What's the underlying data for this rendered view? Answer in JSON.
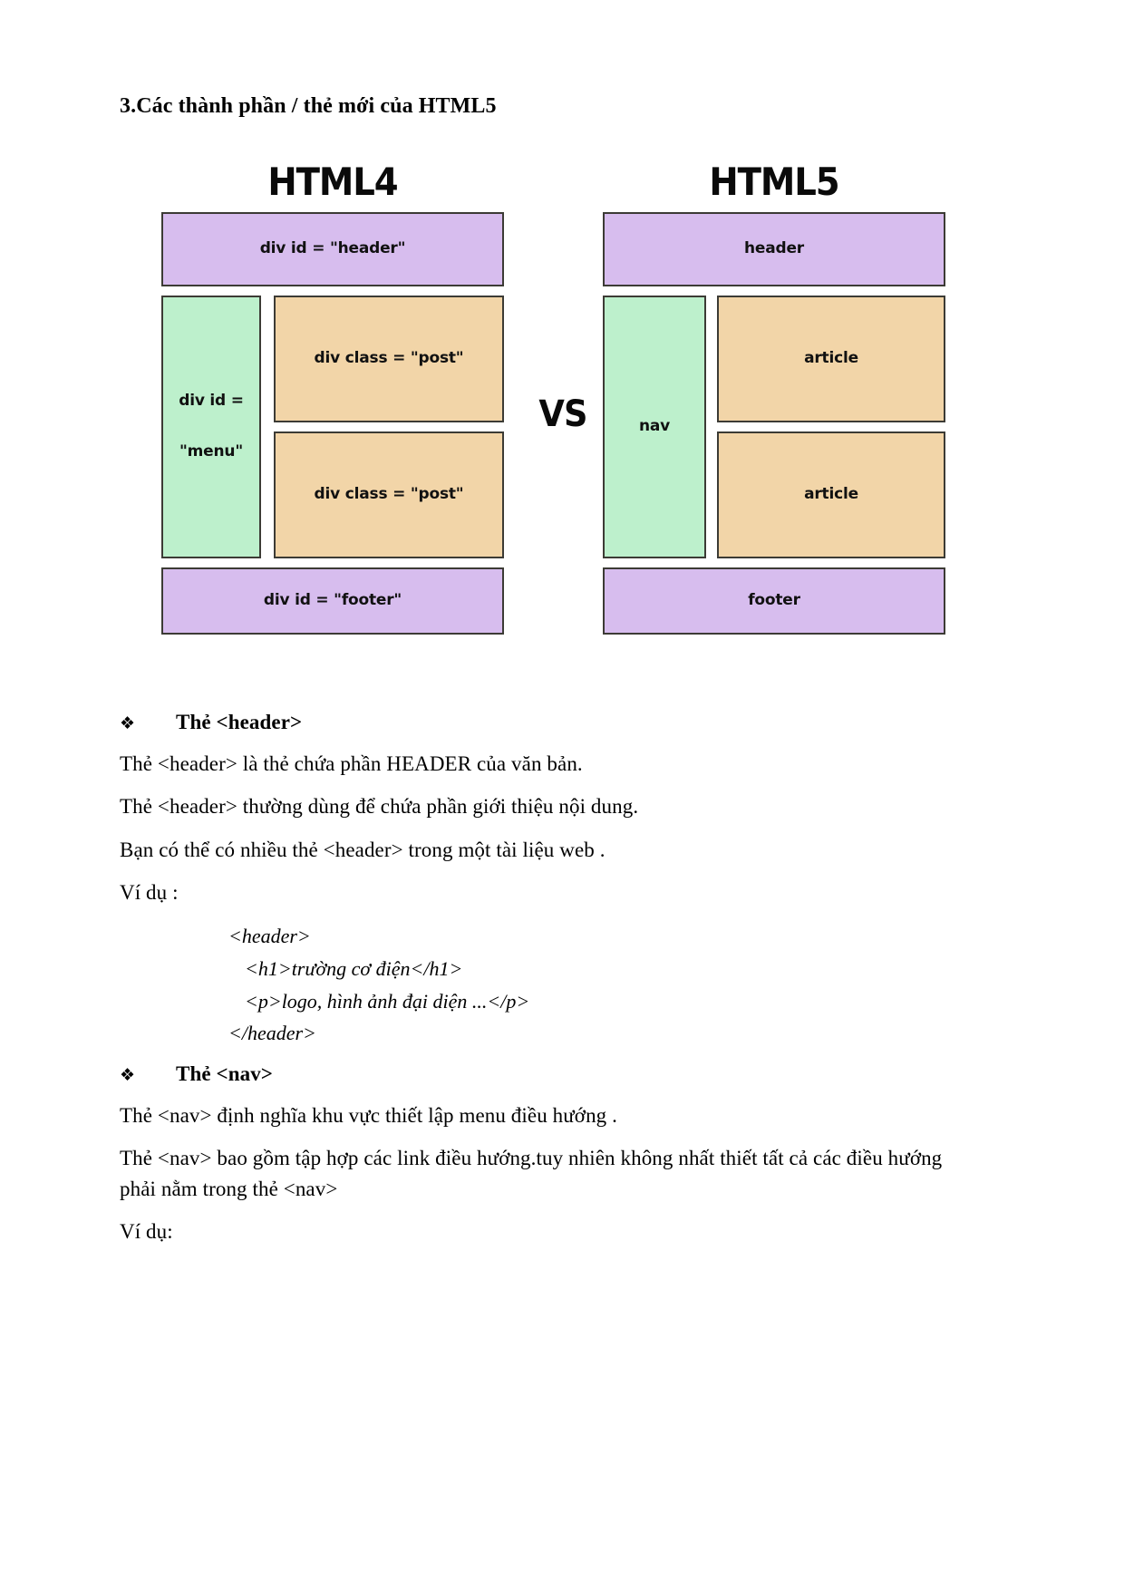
{
  "document": {
    "heading": "3.Các thành phần / thẻ mới của HTML5"
  },
  "figure": {
    "left": {
      "title": "HTML4",
      "header": "div id = \"header\"",
      "side_line1": "div id =",
      "side_line2": "\"menu\"",
      "post1": "div class = \"post\"",
      "post2": "div class = \"post\"",
      "footer": "div id = \"footer\""
    },
    "vs": "VS",
    "right": {
      "title": "HTML5",
      "header": "header",
      "side": "nav",
      "article1": "article",
      "article2": "article",
      "footer": "footer"
    },
    "colors": {
      "purple": "#d7bdee",
      "green": "#bdf0cc",
      "orange": "#f2d5a8",
      "border": "#3c3b35"
    }
  },
  "sections": {
    "header_tag": {
      "bullet_mark": "❖",
      "bullet_text": "Thẻ <header>",
      "paragraphs": [
        "Thẻ <header> là thẻ chứa phần HEADER của văn bản.",
        "Thẻ <header> thường dùng để chứa phần giới thiệu nội dung.",
        "Bạn có thể có nhiều thẻ <header> trong một tài liệu web .",
        "Ví dụ :"
      ],
      "code": [
        "<header>",
        "<h1>trường cơ điện</h1>",
        "<p>logo, hình ảnh đại diện ...</p>",
        "</header>"
      ]
    },
    "nav_tag": {
      "bullet_mark": "❖",
      "bullet_text": "Thẻ <nav>",
      "paragraphs": [
        "Thẻ <nav> định nghĩa khu vực thiết lập menu điều hướng .",
        "Thẻ <nav> bao gồm tập hợp các link điều hướng.tuy nhiên không nhất thiết tất cả các điều hướng phải nằm trong thẻ <nav>",
        "Ví dụ:"
      ]
    }
  }
}
